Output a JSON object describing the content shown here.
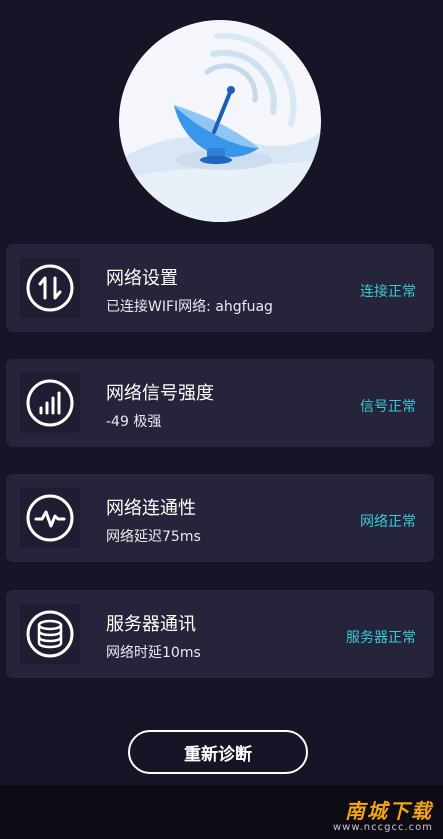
{
  "cards": [
    {
      "title": "网络设置",
      "subtitle": "已连接WIFI网络: ahgfuag",
      "status": "连接正常",
      "icon": "updown-arrows-icon"
    },
    {
      "title": "网络信号强度",
      "subtitle": "-49 极强",
      "status": "信号正常",
      "icon": "signal-bars-icon"
    },
    {
      "title": "网络连通性",
      "subtitle": "网络延迟75ms",
      "status": "网络正常",
      "icon": "pulse-icon"
    },
    {
      "title": "服务器通讯",
      "subtitle": "网络时延10ms",
      "status": "服务器正常",
      "icon": "database-icon"
    }
  ],
  "rediagnose_label": "重新诊断",
  "watermark": {
    "brand": "南城下载",
    "url": "www.nccgcc.com"
  },
  "colors": {
    "background": "#161426",
    "card": "#26243a",
    "status": "#38c9d6",
    "accent": "#2e8fe6"
  }
}
